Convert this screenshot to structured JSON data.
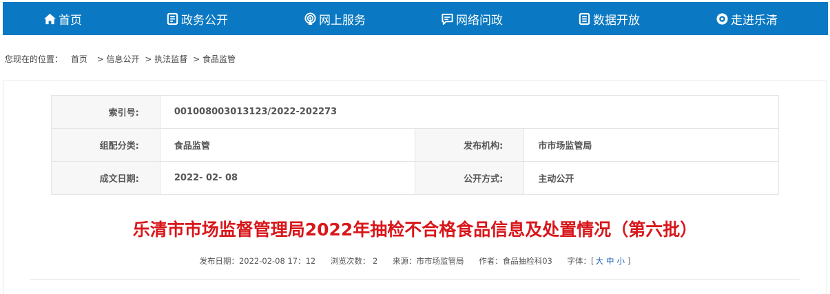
{
  "nav": {
    "items": [
      {
        "label": "首页",
        "icon": "home-icon"
      },
      {
        "label": "政务公开",
        "icon": "document-icon"
      },
      {
        "label": "网上服务",
        "icon": "broadcast-icon"
      },
      {
        "label": "网络问政",
        "icon": "chat-icon"
      },
      {
        "label": "数据开放",
        "icon": "data-icon"
      },
      {
        "label": "走进乐清",
        "icon": "eye-icon"
      }
    ],
    "bg_color": "#0a78c2"
  },
  "breadcrumb": {
    "prefix": "您现在的位置：",
    "items": [
      "首页",
      "> 信息公开",
      "> 执法监督",
      "> 食品监管"
    ]
  },
  "meta": {
    "index_label": "索引号:",
    "index_value": "001008003013123/2022-202273",
    "category_label": "组配分类:",
    "category_value": "食品监管",
    "publisher_label": "发布机构:",
    "publisher_value": "市市场监管局",
    "date_label": "成文日期:",
    "date_value": "2022- 02- 08",
    "method_label": "公开方式:",
    "method_value": "主动公开"
  },
  "article": {
    "title": "乐清市市场监督管理局2022年抽检不合格食品信息及处置情况（第六批）",
    "title_color": "#d8171b",
    "publish_date": "发布日期：2022-02-08 17：12",
    "views": "浏览次数： 2",
    "source": "来源：市市场监管局",
    "author": "作者：食品抽检科03",
    "font_label": "字体：[",
    "font_large": "大",
    "font_medium": "中",
    "font_small": "小",
    "font_end": "]"
  }
}
